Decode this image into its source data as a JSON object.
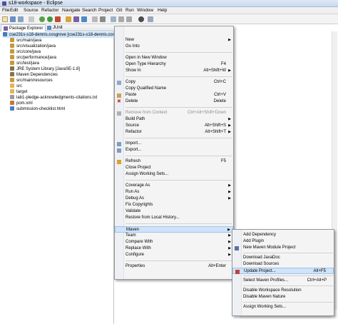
{
  "window": {
    "title": "s18-workspace - Eclipse"
  },
  "menubar": [
    "File",
    "Edit",
    "Source",
    "Refactor",
    "Navigate",
    "Search",
    "Project",
    "Git",
    "Run",
    "Window",
    "Help"
  ],
  "tabs": [
    {
      "label": "Package Explorer",
      "icon": "package-explorer-icon"
    },
    {
      "label": "JUnit",
      "icon": "junit-icon"
    }
  ],
  "tree": [
    {
      "label": "cse231s-s18-dennis.cosgrove [cse231s-s18-dennis.cosgrove",
      "icon": "project-icon",
      "selected": true
    },
    {
      "label": "src/main/java",
      "icon": "source-folder-icon"
    },
    {
      "label": "src/visualization/java",
      "icon": "source-folder-icon"
    },
    {
      "label": "src/core/java",
      "icon": "source-folder-icon"
    },
    {
      "label": "src/performance/java",
      "icon": "source-folder-icon"
    },
    {
      "label": "src/test/java",
      "icon": "source-folder-icon"
    },
    {
      "label": "JRE System Library [JavaSE-1.8]",
      "icon": "library-icon"
    },
    {
      "label": "Maven Dependencies",
      "icon": "library-icon"
    },
    {
      "label": "src/main/resources",
      "icon": "source-folder-icon"
    },
    {
      "label": "src",
      "icon": "folder-icon"
    },
    {
      "label": "target",
      "icon": "folder-icon"
    },
    {
      "label": "lab1-pledge-acknowledgments-citations.txt",
      "icon": "text-file-icon"
    },
    {
      "label": "pom.xml",
      "icon": "xml-file-icon"
    },
    {
      "label": "submission-checklist.html",
      "icon": "html-file-icon"
    }
  ],
  "context_menu": [
    {
      "label": "New",
      "submenu": true
    },
    {
      "label": "Go Into"
    },
    {
      "sep": true
    },
    {
      "label": "Open in New Window"
    },
    {
      "label": "Open Type Hierarchy",
      "shortcut": "F4"
    },
    {
      "label": "Show In",
      "shortcut": "Alt+Shift+W",
      "submenu": true
    },
    {
      "sep": true
    },
    {
      "label": "Copy",
      "shortcut": "Ctrl+C",
      "icon": "copy-icon"
    },
    {
      "label": "Copy Qualified Name"
    },
    {
      "label": "Paste",
      "shortcut": "Ctrl+V",
      "icon": "paste-icon"
    },
    {
      "label": "Delete",
      "shortcut": "Delete",
      "icon": "delete-icon"
    },
    {
      "sep": true
    },
    {
      "label": "Remove from Context",
      "shortcut": "Ctrl+Alt+Shift+Down",
      "disabled": true,
      "icon": "remove-context-icon"
    },
    {
      "label": "Build Path",
      "submenu": true
    },
    {
      "label": "Source",
      "shortcut": "Alt+Shift+S",
      "submenu": true
    },
    {
      "label": "Refactor",
      "shortcut": "Alt+Shift+T",
      "submenu": true
    },
    {
      "sep": true
    },
    {
      "label": "Import...",
      "icon": "import-icon"
    },
    {
      "label": "Export...",
      "icon": "export-icon"
    },
    {
      "sep": true
    },
    {
      "label": "Refresh",
      "shortcut": "F5",
      "icon": "refresh-icon"
    },
    {
      "label": "Close Project"
    },
    {
      "label": "Assign Working Sets..."
    },
    {
      "sep": true
    },
    {
      "label": "Coverage As",
      "submenu": true
    },
    {
      "label": "Run As",
      "submenu": true
    },
    {
      "label": "Debug As",
      "submenu": true
    },
    {
      "label": "Fix Copyrights"
    },
    {
      "label": "Validate"
    },
    {
      "label": "Restore from Local History..."
    },
    {
      "sep": true
    },
    {
      "label": "Maven",
      "submenu": true,
      "highlighted": true
    },
    {
      "label": "Team",
      "submenu": true
    },
    {
      "label": "Compare With",
      "submenu": true
    },
    {
      "label": "Replace With",
      "submenu": true
    },
    {
      "label": "Configure",
      "submenu": true
    },
    {
      "sep": true
    },
    {
      "label": "Properties",
      "shortcut": "Alt+Enter"
    }
  ],
  "maven_submenu": [
    {
      "label": "Add Dependency"
    },
    {
      "label": "Add Plugin"
    },
    {
      "label": "New Maven Module Project",
      "icon": "maven-module-icon"
    },
    {
      "sep": true
    },
    {
      "label": "Download JavaDoc"
    },
    {
      "label": "Download Sources"
    },
    {
      "label": "Update Project...",
      "shortcut": "Alt+F5",
      "icon": "maven-update-icon",
      "highlighted": true
    },
    {
      "sep": true
    },
    {
      "label": "Select Maven Profiles...",
      "shortcut": "Ctrl+Alt+P"
    },
    {
      "sep": true
    },
    {
      "label": "Disable Workspace Resolution"
    },
    {
      "label": "Disable Maven Nature"
    },
    {
      "sep": true
    },
    {
      "label": "Assign Working Sets..."
    }
  ],
  "colors": {
    "highlight": "#cfe3f9",
    "selection": "#cde4fb",
    "source_folder": "#c49a3a",
    "library": "#8b6f4e"
  }
}
